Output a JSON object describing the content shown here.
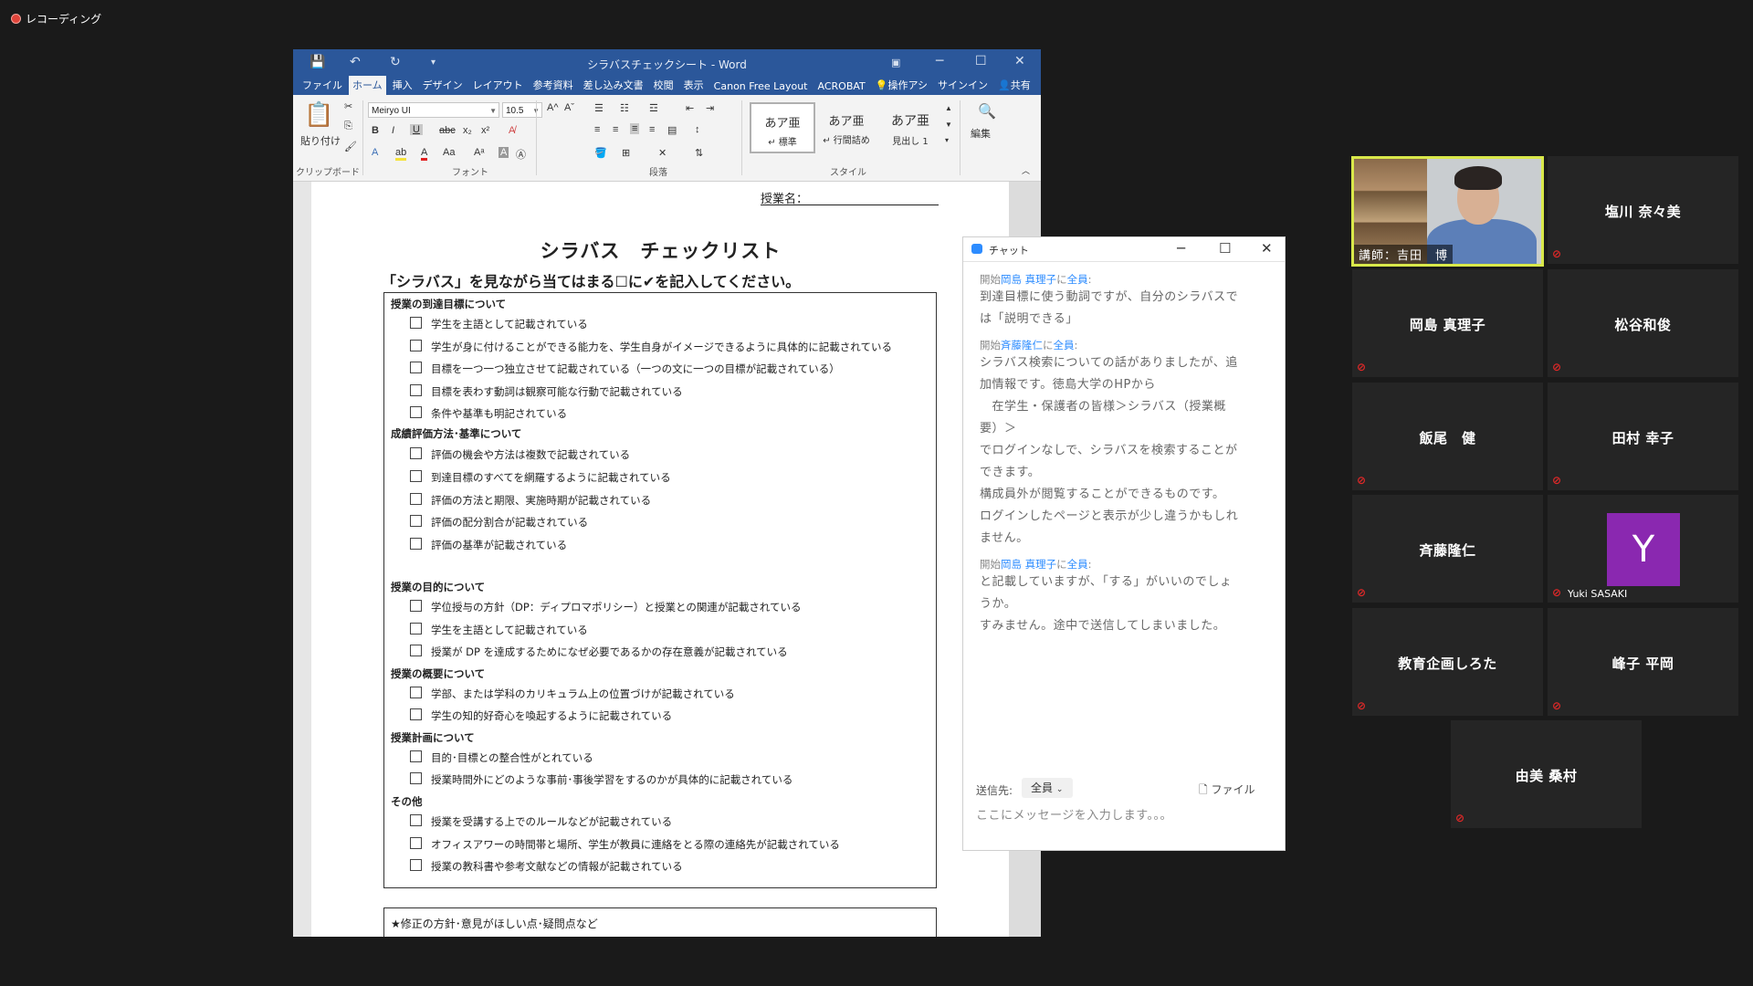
{
  "recording": {
    "label": "レコーディング"
  },
  "word": {
    "title": "シラバスチェックシート - Word",
    "tabs": [
      "ファイル",
      "ホーム",
      "挿入",
      "デザイン",
      "レイアウト",
      "参考資料",
      "差し込み文書",
      "校閲",
      "表示",
      "Canon Free Layout",
      "ACROBAT"
    ],
    "tell_me": "操作アシ",
    "signin": "サインイン",
    "share": "共有",
    "ribbon": {
      "paste": "貼り付け",
      "font_name": "Meiryo UI",
      "font_size": "10.5",
      "styles": [
        {
          "preview": "あア亜",
          "name": "↵ 標準"
        },
        {
          "preview": "あア亜",
          "name": "↵ 行間詰め"
        },
        {
          "preview": "あア亜",
          "name": "見出し 1"
        }
      ],
      "edit": "編集",
      "group_labels": {
        "clipboard": "クリップボード",
        "font": "フォント",
        "paragraph": "段落",
        "style": "スタイル"
      }
    },
    "document": {
      "subject_label": "授業名：",
      "title": "シラバス　チェックリスト",
      "instruction": "「シラバス」を見ながら当てはまる☐に✔を記入してください。",
      "sections": [
        {
          "heading": "授業の到達目標について",
          "items": [
            "学生を主語として記載されている",
            "学生が身に付けることができる能力を、学生自身がイメージできるように具体的に記載されている",
            "目標を一つ一つ独立させて記載されている（一つの文に一つの目標が記載されている）",
            "目標を表わす動詞は観察可能な行動で記載されている",
            "条件や基準も明記されている"
          ]
        },
        {
          "heading": "成績評価方法･基準について",
          "items": [
            "評価の機会や方法は複数で記載されている",
            "到達目標のすべてを網羅するように記載されている",
            "評価の方法と期限、実施時期が記載されている",
            "評価の配分割合が記載されている",
            "評価の基準が記載されている"
          ]
        },
        {
          "heading": "授業の目的について",
          "items": [
            "学位授与の方針（DP：ディプロマポリシー）と授業との関連が記載されている",
            "学生を主語として記載されている",
            "授業が DP を達成するためになぜ必要であるかの存在意義が記載されている"
          ]
        },
        {
          "heading": "授業の概要について",
          "items": [
            "学部、または学科のカリキュラム上の位置づけが記載されている",
            "学生の知的好奇心を喚起するように記載されている"
          ]
        },
        {
          "heading": "授業計画について",
          "items": [
            "目的･目標との整合性がとれている",
            "授業時間外にどのような事前･事後学習をするのかが具体的に記載されている"
          ]
        },
        {
          "heading": "その他",
          "items": [
            "授業を受講する上でのルールなどが記載されている",
            "オフィスアワーの時間帯と場所、学生が教員に連絡をとる際の連絡先が記載されている",
            "授業の教科書や参考文献などの情報が記載されている"
          ]
        }
      ],
      "bottom_box": "★修正の方針･意見がほしい点･疑問点など"
    }
  },
  "chat": {
    "title": "チャット",
    "messages": [
      {
        "prefix": "開始",
        "from": "岡島 真理子",
        "mid": "に",
        "to": "全員",
        "colon": ":",
        "lines": [
          "到達目標に使う動詞ですが、自分のシラバスで",
          "は「説明できる」"
        ]
      },
      {
        "prefix": "開始",
        "from": "斉藤隆仁",
        "mid": "に",
        "to": "全員",
        "colon": ":",
        "lines": [
          "シラバス検索についての話がありましたが、追",
          "加情報です。徳島大学のHPから",
          "　在学生・保護者の皆様＞シラバス（授業概",
          "要）＞",
          "でログインなしで、シラバスを検索することが",
          "できます。",
          "構成員外が閲覧することができるものです。",
          "ログインしたページと表示が少し違うかもしれ",
          "ません。"
        ]
      },
      {
        "prefix": "開始",
        "from": "岡島 真理子",
        "mid": "に",
        "to": "全員",
        "colon": ":",
        "lines": [
          "と記載していますが、「する」がいいのでしょ",
          "うか。",
          "すみません。途中で送信してしまいました。"
        ]
      }
    ],
    "send_to_label": "送信先:",
    "send_to_value": "全員",
    "file_label": "ファイル",
    "input_placeholder": "ここにメッセージを入力します。。。"
  },
  "participants": {
    "video": {
      "label": "講師：吉田　博"
    },
    "tiles": [
      "塩川 奈々美",
      "岡島 真理子",
      "松谷和俊",
      "飯尾　健",
      "田村 幸子",
      "斉藤隆仁",
      "",
      "教育企画しろた",
      "峰子 平岡",
      "由美 桑村"
    ],
    "avatar": {
      "letter": "Y",
      "name": "Yuki SASAKI"
    }
  }
}
